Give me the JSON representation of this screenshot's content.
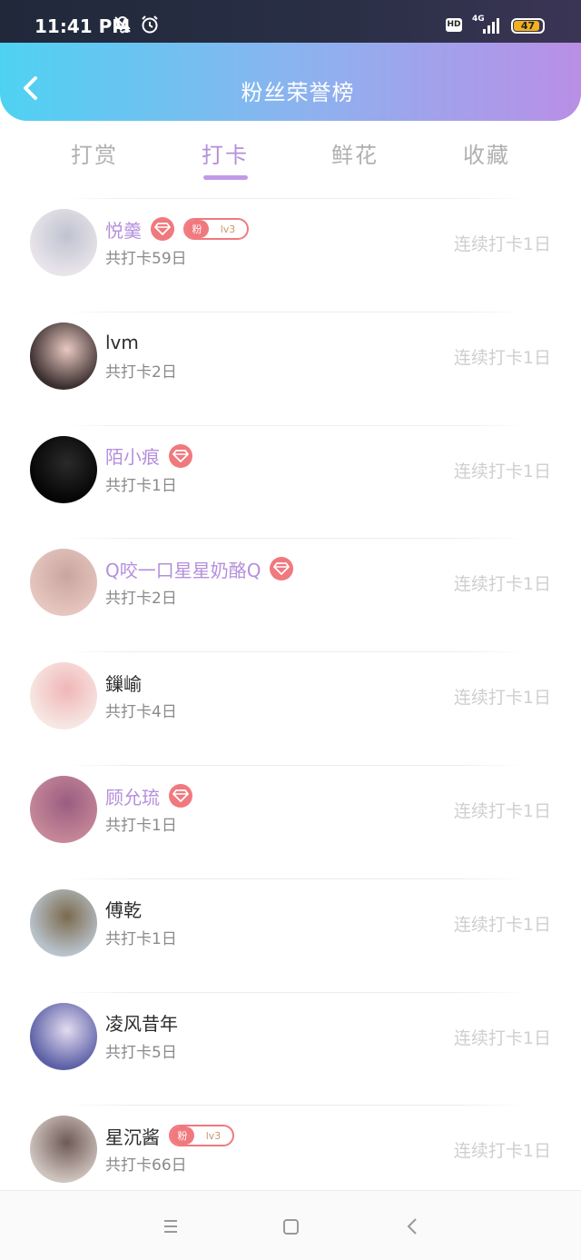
{
  "status_bar": {
    "time": "11:41 PM",
    "hd": "HD",
    "network": "4G",
    "battery": "47",
    "icons": [
      "bell-off-icon",
      "alarm-icon",
      "signal-icon",
      "battery-icon"
    ]
  },
  "header": {
    "title": "粉丝荣誉榜",
    "back_icon": "chevron-left-icon"
  },
  "tabs": [
    {
      "label": "打赏",
      "active": false
    },
    {
      "label": "打卡",
      "active": true
    },
    {
      "label": "鲜花",
      "active": false
    },
    {
      "label": "收藏",
      "active": false
    }
  ],
  "fans": [
    {
      "name": "悦羹",
      "vip": true,
      "gem": true,
      "fan_badge": {
        "label": "粉",
        "level": "lv3"
      },
      "total": "共打卡59日",
      "streak": "连续打卡1日",
      "avatar_colors": [
        "#e9e4ea",
        "#bfc3d0"
      ]
    },
    {
      "name": "lvm",
      "vip": false,
      "gem": false,
      "fan_badge": null,
      "total": "共打卡2日",
      "streak": "连续打卡1日",
      "avatar_colors": [
        "#3a2e2e",
        "#e9c9c2"
      ]
    },
    {
      "name": "陌小痕",
      "vip": true,
      "gem": true,
      "fan_badge": null,
      "total": "共打卡1日",
      "streak": "连续打卡1日",
      "avatar_colors": [
        "#050505",
        "#2a2a2a"
      ]
    },
    {
      "name": "Q咬一口星星奶酪Q",
      "vip": true,
      "gem": true,
      "fan_badge": null,
      "total": "共打卡2日",
      "streak": "连续打卡1日",
      "avatar_colors": [
        "#e7c6c0",
        "#c9a59f"
      ]
    },
    {
      "name": "鏁崳",
      "vip": false,
      "gem": false,
      "fan_badge": null,
      "total": "共打卡4日",
      "streak": "连续打卡1日",
      "avatar_colors": [
        "#f6e7e3",
        "#f1b5b7"
      ]
    },
    {
      "name": "顾允琉",
      "vip": true,
      "gem": true,
      "fan_badge": null,
      "total": "共打卡1日",
      "streak": "连续打卡1日",
      "avatar_colors": [
        "#c58798",
        "#9a5d80"
      ]
    },
    {
      "name": "傅乾",
      "vip": false,
      "gem": false,
      "fan_badge": null,
      "total": "共打卡1日",
      "streak": "连续打卡1日",
      "avatar_colors": [
        "#b9c3cc",
        "#7b6a4e"
      ]
    },
    {
      "name": "凌风昔年",
      "vip": false,
      "gem": false,
      "fan_badge": null,
      "total": "共打卡5日",
      "streak": "连续打卡1日",
      "avatar_colors": [
        "#5b5fa6",
        "#e3dcf0"
      ]
    },
    {
      "name": "星沉酱",
      "vip": false,
      "gem": false,
      "fan_badge": {
        "label": "粉",
        "level": "lv3"
      },
      "total": "共打卡66日",
      "streak": "连续打卡1日",
      "avatar_colors": [
        "#cfc3bd",
        "#6e5a57"
      ]
    }
  ],
  "nav_bar": {
    "icons": [
      "menu-icon",
      "home-square-icon",
      "back-triangle-icon"
    ]
  },
  "colors": {
    "accent": "#b58fdc",
    "badge": "#f0797e",
    "header_start": "#4fd2f2",
    "header_end": "#b98fe6"
  }
}
